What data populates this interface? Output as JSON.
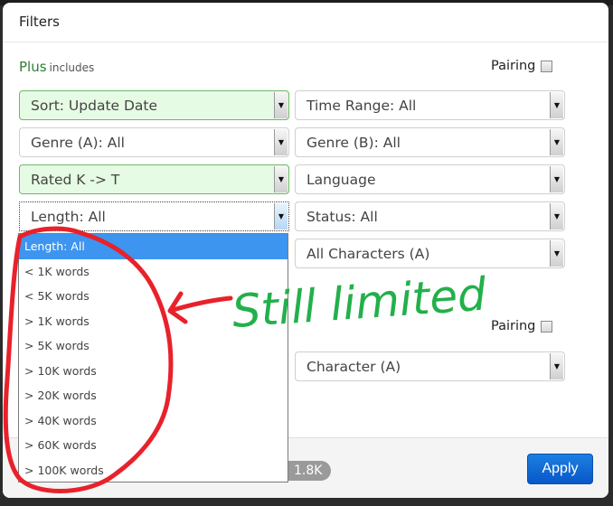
{
  "modal": {
    "title": "Filters",
    "section_plus": {
      "label": "Plus",
      "sub": "includes"
    },
    "pairing_label": "Pairing",
    "pairing_checked": false,
    "pairing2_label": "Pairing",
    "pairing2_checked": false
  },
  "filters": {
    "sort": "Sort: Update Date",
    "time_range": "Time Range: All",
    "genre_a": "Genre (A): All",
    "genre_b": "Genre (B): All",
    "rated": "Rated K -> T",
    "language": "Language",
    "length": "Length: All",
    "status": "Status: All",
    "characters_a": "All Characters (A)",
    "character_a2": "Character (A)"
  },
  "length_dropdown": {
    "selected": "Length: All",
    "options": [
      "Length: All",
      "< 1K words",
      "< 5K words",
      "> 1K words",
      "> 5K words",
      "> 10K words",
      "> 20K words",
      "> 40K words",
      "> 60K words",
      "> 100K words"
    ]
  },
  "footer": {
    "count": "1.8K",
    "apply_label": "Apply"
  },
  "annotation": {
    "text": "Still limited",
    "text_color": "#22b04a",
    "circle_color": "#e8212a"
  }
}
